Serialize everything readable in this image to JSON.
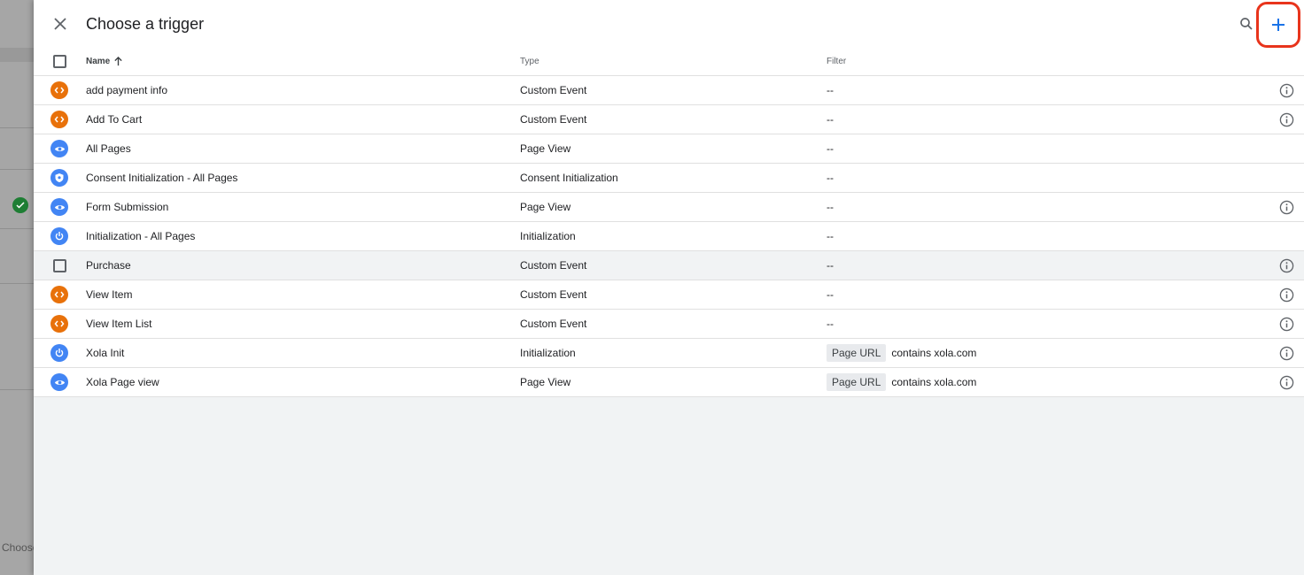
{
  "background": {
    "side_text": "Choose"
  },
  "dialog": {
    "title": "Choose a trigger",
    "icons": {
      "close": "close-icon",
      "search": "search-icon",
      "add": "add-icon"
    },
    "colors": {
      "accent": "#1a73e8",
      "highlight": "#e8341c",
      "custom_event": "#e8710a",
      "page_view": "#4285f4"
    }
  },
  "columns": {
    "name": "Name",
    "type": "Type",
    "filter": "Filter"
  },
  "triggers": [
    {
      "name": "add payment info",
      "type": "Custom Event",
      "filter": "--",
      "icon": "custom-event-icon",
      "info": true
    },
    {
      "name": "Add To Cart",
      "type": "Custom Event",
      "filter": "--",
      "icon": "custom-event-icon",
      "info": true
    },
    {
      "name": "All Pages",
      "type": "Page View",
      "filter": "--",
      "icon": "page-view-icon",
      "info": false
    },
    {
      "name": "Consent Initialization - All Pages",
      "type": "Consent Initialization",
      "filter": "--",
      "icon": "consent-shield-icon",
      "info": false
    },
    {
      "name": "Form Submission",
      "type": "Page View",
      "filter": "--",
      "icon": "page-view-icon",
      "info": true
    },
    {
      "name": "Initialization - All Pages",
      "type": "Initialization",
      "filter": "--",
      "icon": "power-icon",
      "info": false
    },
    {
      "name": "Purchase",
      "type": "Custom Event",
      "filter": "--",
      "icon": "checkbox",
      "info": true
    },
    {
      "name": "View Item",
      "type": "Custom Event",
      "filter": "--",
      "icon": "custom-event-icon",
      "info": true
    },
    {
      "name": "View Item List",
      "type": "Custom Event",
      "filter": "--",
      "icon": "custom-event-icon",
      "info": true
    },
    {
      "name": "Xola Init",
      "type": "Initialization",
      "filter_key": "Page URL",
      "filter_value": "contains xola.com",
      "icon": "power-icon",
      "info": true
    },
    {
      "name": "Xola Page view",
      "type": "Page View",
      "filter_key": "Page URL",
      "filter_value": "contains xola.com",
      "icon": "page-view-icon",
      "info": true
    }
  ]
}
